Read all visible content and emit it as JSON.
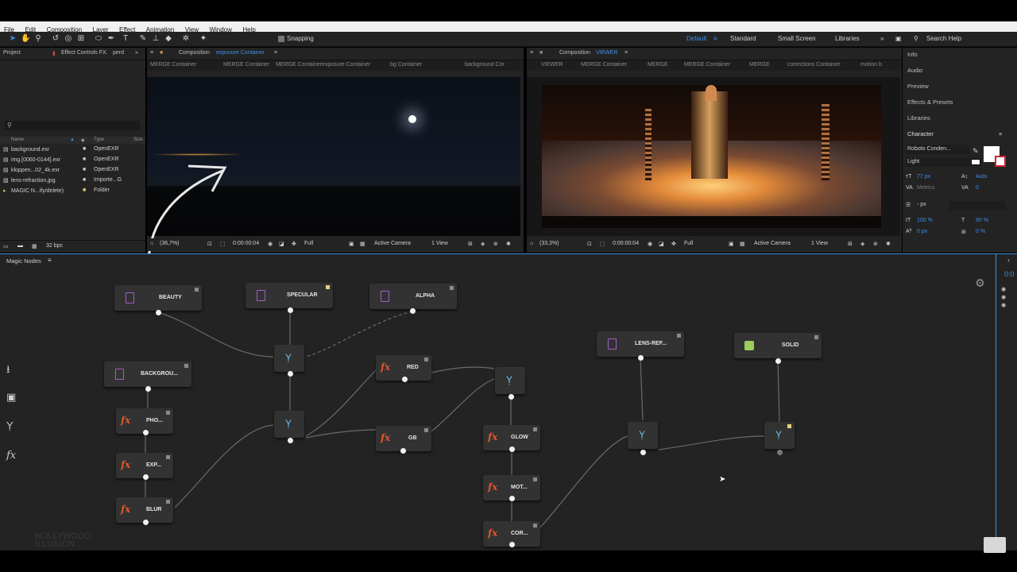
{
  "menu": [
    "File",
    "Edit",
    "Composition",
    "Layer",
    "Effect",
    "Animation",
    "View",
    "Window",
    "Help"
  ],
  "toolbar": {
    "snapping": "Snapping",
    "workspaces": [
      "Default",
      "Standard",
      "Small Screen",
      "Libraries"
    ],
    "search": "Search Help"
  },
  "project": {
    "tabs": [
      "Project",
      "Effect Controls FX.",
      "perd"
    ],
    "columns": [
      "Name",
      "Type",
      "Size"
    ],
    "items": [
      {
        "name": "background.exr",
        "type": "OpenEXR"
      },
      {
        "name": "img.[0060-0144].exr",
        "type": "OpenEXR"
      },
      {
        "name": "kloppen...02_4k.exr",
        "type": "OpenEXR"
      },
      {
        "name": "lens-refraction.jpg",
        "type": "Importe...G"
      },
      {
        "name": "MAGIC N...ify/delete)",
        "type": "Folder"
      }
    ],
    "bpc": "32 bpc"
  },
  "comp_left": {
    "title": "Composition",
    "name": "exposure Container",
    "crumbs": [
      "MERGE Container",
      "MERGE Container",
      "MERGE Container",
      "exposure Container",
      "bg Container",
      "background Cor"
    ],
    "zoom": "(36,7%)",
    "time": "0:00:00:04",
    "res": "Full",
    "camera": "Active Camera",
    "view": "1 View"
  },
  "comp_right": {
    "title": "Composition",
    "name": "VIEWER",
    "crumbs": [
      "VIEWER",
      "MERGE Container",
      "MERGE",
      "MERGE Container",
      "MERGE",
      "corrections Container",
      "motion b"
    ],
    "zoom": "(33,3%)",
    "time": "0:00:00:04",
    "res": "Full",
    "camera": "Active Camera",
    "view": "1 View"
  },
  "right_panel": {
    "items": [
      "Info",
      "Audio",
      "Preview",
      "Effects & Presets",
      "Libraries"
    ],
    "character": "Character",
    "font": "Roboto Conden...",
    "style": "Light",
    "size": "77 px",
    "leading": "Auto",
    "tracking": "0",
    "kerning": "Metrics",
    "stroke_unit": "- px",
    "vscale": "100 %",
    "hscale": "90 %",
    "baseline": "0 px",
    "tsume": "0 %"
  },
  "magic": {
    "title": "Magic Nodes",
    "timecode": "0:0",
    "nodes": {
      "beauty": "BEAUTY",
      "specular": "SPECULAR",
      "alpha": "ALPHA",
      "background": "BACKGROU...",
      "pho": "PHO...",
      "exp": "EXP...",
      "blur": "BLUR",
      "red": "RED",
      "gb": "GB",
      "glow": "GLOW",
      "mot": "MOT...",
      "cor": "COR...",
      "lens": "LENS-REF...",
      "solid": "SOLID"
    },
    "watermark": [
      "HOLLYWOOD",
      "ILLUSION"
    ]
  },
  "colors": {
    "accent": "#3d8fe8",
    "fx": "#e2562d",
    "file": "#a35fc7",
    "merge": "#6fc3e8",
    "solid": "#9ccd5f"
  }
}
